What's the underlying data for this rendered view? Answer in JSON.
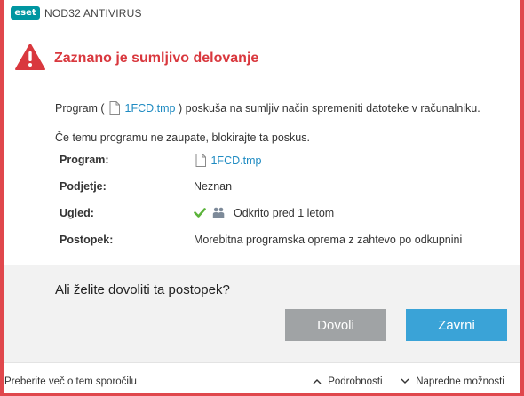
{
  "app": {
    "logo_text": "eset",
    "product_name": "NOD32 ANTIVIRUS",
    "brand_color": "#0096a1"
  },
  "alert": {
    "title": "Zaznano je sumljivo delovanje",
    "icon": "warning-icon",
    "color": "#d9383e"
  },
  "message": {
    "line1_prefix": "Program (",
    "line1_file": "1FCD.tmp",
    "line1_suffix": ") poskuša na sumljiv način spremeniti datoteke v računalniku.",
    "line2": "Če temu programu ne zaupate, blokirajte ta poskus."
  },
  "details": [
    {
      "label": "Program:",
      "value": "1FCD.tmp",
      "icon": "file-icon"
    },
    {
      "label": "Podjetje:",
      "value": "Neznan"
    },
    {
      "label": "Ugled:",
      "value": "Odkrito pred 1 letom",
      "icons": [
        "checkmark-icon",
        "users-icon"
      ]
    },
    {
      "label": "Postopek:",
      "value": "Morebitna programska oprema z zahtevo po odkupnini"
    }
  ],
  "prompt": {
    "question": "Ali želite dovoliti ta postopek?",
    "allow_label": "Dovoli",
    "deny_label": "Zavrni"
  },
  "footer": {
    "learn_more": "Preberite več o tem sporočilu",
    "details_label": "Podrobnosti",
    "advanced_label": "Napredne možnosti"
  },
  "colors": {
    "border": "#e0474c",
    "link": "#1f8bc2",
    "allow_button": "#a0a3a5",
    "deny_button": "#3aa3d7",
    "check": "#5bb33a"
  }
}
